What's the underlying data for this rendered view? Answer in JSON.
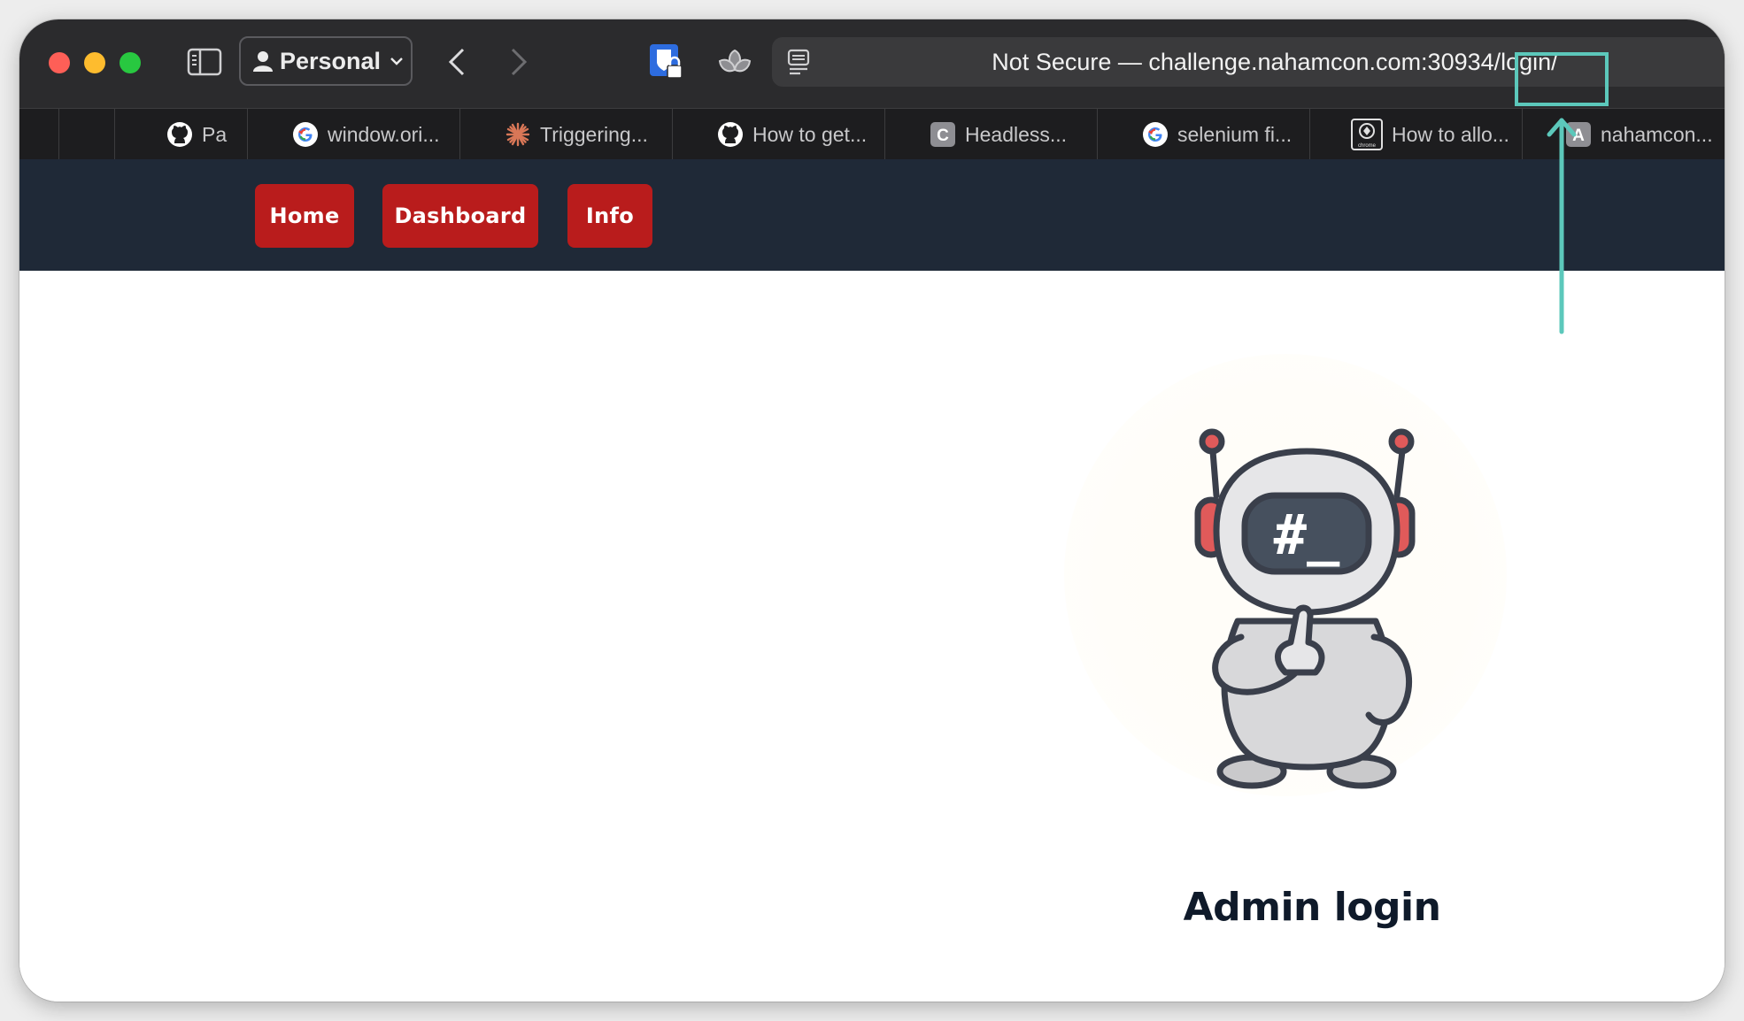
{
  "browser": {
    "profile_label": "Personal",
    "url_text": "Not Secure — challenge.nahamcon.com:30934/login/",
    "tabs": [
      {
        "label": "Pa",
        "icon": "github-icon"
      },
      {
        "label": "window.ori...",
        "icon": "google-icon"
      },
      {
        "label": "Triggering...",
        "icon": "claude-icon"
      },
      {
        "label": "How to get...",
        "icon": "github-icon"
      },
      {
        "label": "Headless...",
        "icon": "c-letter-icon",
        "icon_letter": "C"
      },
      {
        "label": "selenium fi...",
        "icon": "google-icon"
      },
      {
        "label": "How to allo...",
        "icon": "chrome-docs-icon",
        "icon_caption": "chrome"
      },
      {
        "label": "nahamcon...",
        "icon": "a-letter-icon",
        "icon_letter": "A"
      }
    ]
  },
  "site": {
    "nav": {
      "home": "Home",
      "dashboard": "Dashboard",
      "info": "Info"
    },
    "robot_screen_text": "#_",
    "heading": "Admin login"
  },
  "colors": {
    "nav_bg": "#1f2937",
    "button_red": "#b91c1c",
    "highlight": "#5cc8bb"
  }
}
